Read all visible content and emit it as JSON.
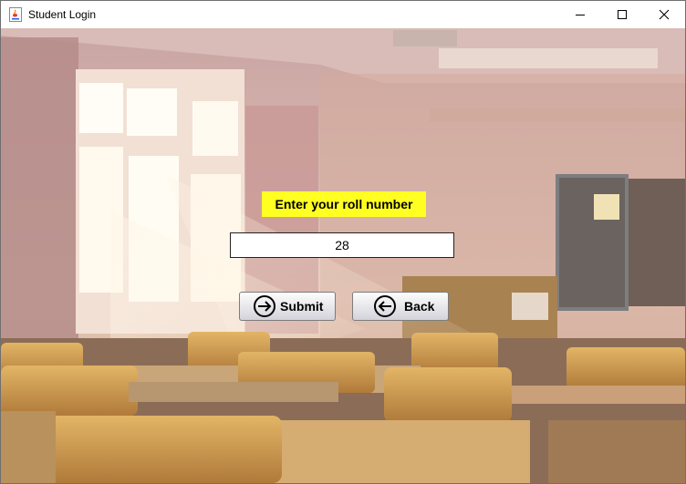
{
  "window": {
    "title": "Student Login"
  },
  "form": {
    "prompt_label": "Enter your roll number",
    "roll_value": "28"
  },
  "buttons": {
    "submit_label": "Submit",
    "back_label": "Back"
  }
}
